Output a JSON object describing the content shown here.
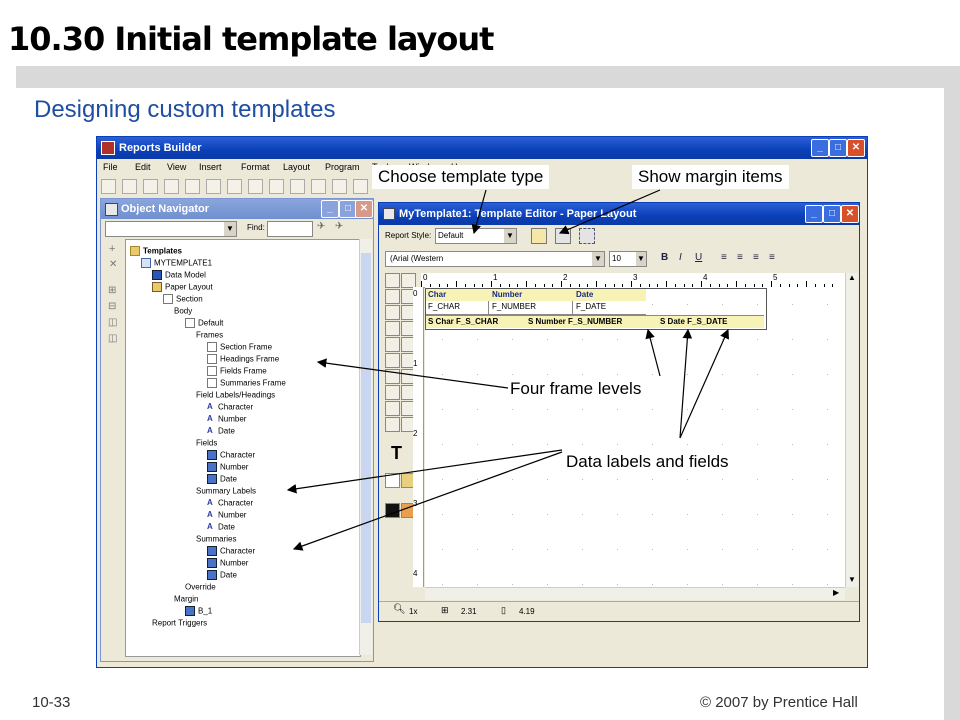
{
  "slide": {
    "title": "10.30 Initial template layout",
    "subtitle": "Designing custom templates",
    "footer_left": "10-33",
    "footer_right": "© 2007 by Prentice Hall"
  },
  "app": {
    "title": "Reports Builder",
    "menu": [
      "File",
      "Edit",
      "View",
      "Insert",
      "Format",
      "Layout",
      "Program",
      "Tools",
      "Window",
      "H"
    ]
  },
  "navigator": {
    "title": "Object Navigator",
    "find_label": "Find:",
    "tree": [
      {
        "label": "Templates",
        "depth": 0,
        "icon": "folder",
        "bold": true
      },
      {
        "label": "MYTEMPLATE1",
        "depth": 1,
        "icon": "report"
      },
      {
        "label": "Data Model",
        "depth": 2,
        "icon": "data-model"
      },
      {
        "label": "Paper Layout",
        "depth": 2,
        "icon": "layout"
      },
      {
        "label": "Section",
        "depth": 3,
        "icon": "page"
      },
      {
        "label": "Body",
        "depth": 4,
        "icon": "none"
      },
      {
        "label": "Default",
        "depth": 5,
        "icon": "page"
      },
      {
        "label": "Frames",
        "depth": 6,
        "icon": "none"
      },
      {
        "label": "Section Frame",
        "depth": 7,
        "icon": "page"
      },
      {
        "label": "Headings Frame",
        "depth": 7,
        "icon": "page"
      },
      {
        "label": "Fields Frame",
        "depth": 7,
        "icon": "page"
      },
      {
        "label": "Summaries Frame",
        "depth": 7,
        "icon": "page"
      },
      {
        "label": "Field Labels/Headings",
        "depth": 6,
        "icon": "none"
      },
      {
        "label": "Character",
        "depth": 7,
        "icon": "A"
      },
      {
        "label": "Number",
        "depth": 7,
        "icon": "A"
      },
      {
        "label": "Date",
        "depth": 7,
        "icon": "A"
      },
      {
        "label": "Fields",
        "depth": 6,
        "icon": "none"
      },
      {
        "label": "Character",
        "depth": 7,
        "icon": "field"
      },
      {
        "label": "Number",
        "depth": 7,
        "icon": "field"
      },
      {
        "label": "Date",
        "depth": 7,
        "icon": "field"
      },
      {
        "label": "Summary Labels",
        "depth": 6,
        "icon": "none"
      },
      {
        "label": "Character",
        "depth": 7,
        "icon": "A"
      },
      {
        "label": "Number",
        "depth": 7,
        "icon": "A"
      },
      {
        "label": "Date",
        "depth": 7,
        "icon": "A"
      },
      {
        "label": "Summaries",
        "depth": 6,
        "icon": "none"
      },
      {
        "label": "Character",
        "depth": 7,
        "icon": "field"
      },
      {
        "label": "Number",
        "depth": 7,
        "icon": "field"
      },
      {
        "label": "Date",
        "depth": 7,
        "icon": "field"
      },
      {
        "label": "Override",
        "depth": 5,
        "icon": "none"
      },
      {
        "label": "Margin",
        "depth": 4,
        "icon": "none"
      },
      {
        "label": "B_1",
        "depth": 5,
        "icon": "field"
      },
      {
        "label": "Report Triggers",
        "depth": 2,
        "icon": "none"
      }
    ]
  },
  "editor": {
    "title": "MyTemplate1: Template Editor - Paper Layout",
    "report_style_label": "Report Style:",
    "report_style_value": "Default",
    "font_value": "(Arial (Western",
    "font_size": "10",
    "ruler_numbers": [
      "0",
      "1",
      "2",
      "3",
      "4",
      "5"
    ],
    "vruler_numbers": [
      "0",
      "1",
      "2",
      "3",
      "4"
    ],
    "headers": [
      "Char",
      "Number",
      "Date"
    ],
    "fields": [
      "F_CHAR",
      "F_NUMBER",
      "F_DATE"
    ],
    "summaries": [
      "S Char F_S_CHAR",
      "S Number F_S_NUMBER",
      "S Date F_S_DATE"
    ],
    "status": {
      "zoom": "1x",
      "pos_x": "2.31",
      "pos_y": "4.19"
    }
  },
  "callouts": {
    "template_type": "Choose template type",
    "margin_items": "Show margin items",
    "frame_levels": "Four frame levels",
    "labels_fields": "Data labels and fields"
  }
}
